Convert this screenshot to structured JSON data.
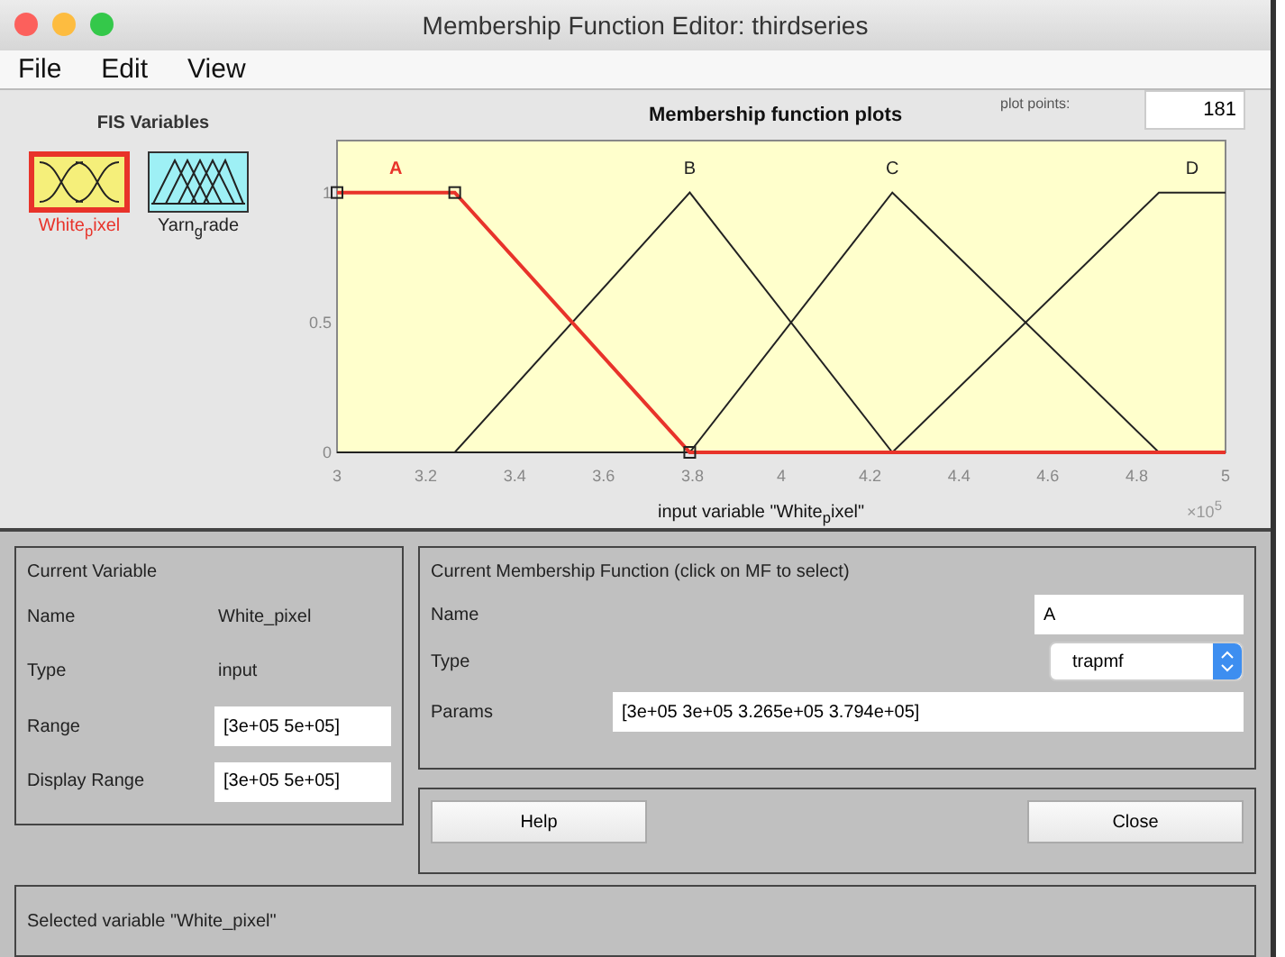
{
  "window": {
    "title": "Membership Function Editor: thirdseries"
  },
  "menu": [
    "File",
    "Edit",
    "View"
  ],
  "fis_variables": {
    "title": "FIS Variables",
    "items": [
      {
        "label": "White$_{p}$ixel",
        "kind": "gauss",
        "selected": true
      },
      {
        "label": "Yarn$_{g}$rade",
        "kind": "tri",
        "selected": false
      }
    ]
  },
  "plot": {
    "title": "Membership function plots",
    "plot_points_label": "plot points:",
    "plot_points": "181",
    "xlabel": "input variable \"White$_{p}$ixel\"",
    "exponent": "×10$^{5}$",
    "chart_data": {
      "type": "line",
      "x": [
        3,
        3.265,
        3.794,
        4.25,
        4.85,
        5
      ],
      "series": [
        {
          "name": "A",
          "color": "#e8332a",
          "values": [
            1,
            1,
            0,
            0,
            0,
            0
          ]
        },
        {
          "name": "B",
          "color": "#222222",
          "values": [
            0,
            0,
            1,
            0,
            0,
            0
          ]
        },
        {
          "name": "C",
          "color": "#222222",
          "values": [
            0,
            0,
            0,
            1,
            0,
            0
          ]
        },
        {
          "name": "D",
          "color": "#222222",
          "values": [
            0,
            0,
            0,
            0,
            1,
            1
          ]
        }
      ],
      "xlim": [
        3,
        5
      ],
      "ylim": [
        0,
        1.2
      ],
      "xticks": [
        3,
        3.2,
        3.4,
        3.6,
        3.8,
        4,
        4.2,
        4.4,
        4.6,
        4.8,
        5
      ],
      "yticks": [
        0,
        0.5,
        1
      ]
    }
  },
  "current_variable": {
    "title": "Current Variable",
    "name_label": "Name",
    "name": "White_pixel",
    "type_label": "Type",
    "type": "input",
    "range_label": "Range",
    "range": "[3e+05 5e+05]",
    "display_range_label": "Display Range",
    "display_range": "[3e+05 5e+05]"
  },
  "current_mf": {
    "title": "Current Membership Function (click on MF to select)",
    "name_label": "Name",
    "name": "A",
    "type_label": "Type",
    "type": "trapmf",
    "params_label": "Params",
    "params": "[3e+05 3e+05 3.265e+05 3.794e+05]"
  },
  "buttons": [
    "Help",
    "Close"
  ],
  "status": "Selected variable \"White_pixel\""
}
